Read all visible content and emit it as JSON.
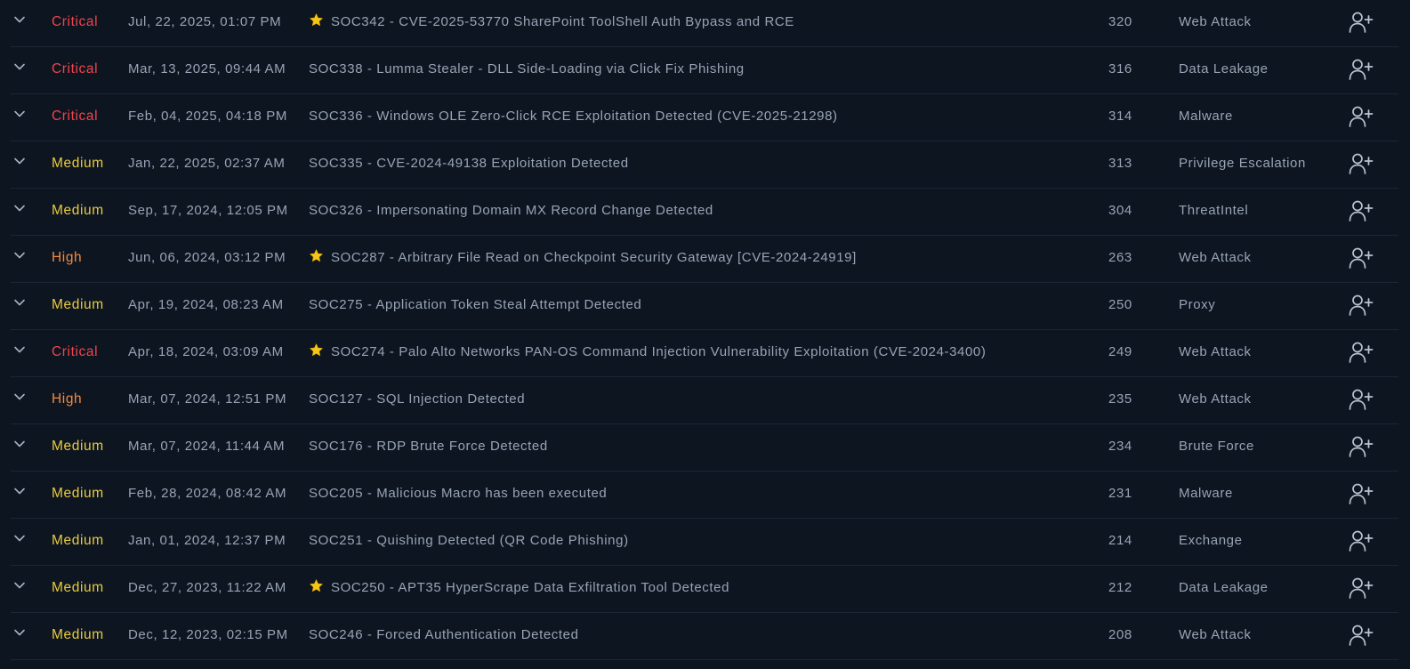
{
  "colors": {
    "background": "#0d1521",
    "row_divider": "#1c2634",
    "text": "#98a4b5",
    "critical": "#f0444a",
    "high": "#f48a3e",
    "medium": "#e9cb3c",
    "star": "#f5c518"
  },
  "icons": {
    "expand": "chevron-down-icon",
    "featured": "star-icon",
    "assign": "user-plus-icon"
  },
  "alerts": [
    {
      "severity": "Critical",
      "date": "Jul, 22, 2025, 01:07 PM",
      "starred": true,
      "rule": "SOC342 - CVE-2025-53770 SharePoint ToolShell Auth Bypass and RCE",
      "event_id": "320",
      "type": "Web Attack"
    },
    {
      "severity": "Critical",
      "date": "Mar, 13, 2025, 09:44 AM",
      "starred": false,
      "rule": "SOC338 - Lumma Stealer - DLL Side-Loading via Click Fix Phishing",
      "event_id": "316",
      "type": "Data Leakage"
    },
    {
      "severity": "Critical",
      "date": "Feb, 04, 2025, 04:18 PM",
      "starred": false,
      "rule": "SOC336 - Windows OLE Zero-Click RCE Exploitation Detected (CVE-2025-21298)",
      "event_id": "314",
      "type": "Malware"
    },
    {
      "severity": "Medium",
      "date": "Jan, 22, 2025, 02:37 AM",
      "starred": false,
      "rule": "SOC335 - CVE-2024-49138 Exploitation Detected",
      "event_id": "313",
      "type": "Privilege Escalation"
    },
    {
      "severity": "Medium",
      "date": "Sep, 17, 2024, 12:05 PM",
      "starred": false,
      "rule": "SOC326 - Impersonating Domain MX Record Change Detected",
      "event_id": "304",
      "type": "ThreatIntel"
    },
    {
      "severity": "High",
      "date": "Jun, 06, 2024, 03:12 PM",
      "starred": true,
      "rule": "SOC287 - Arbitrary File Read on Checkpoint Security Gateway [CVE-2024-24919]",
      "event_id": "263",
      "type": "Web Attack"
    },
    {
      "severity": "Medium",
      "date": "Apr, 19, 2024, 08:23 AM",
      "starred": false,
      "rule": "SOC275 - Application Token Steal Attempt Detected",
      "event_id": "250",
      "type": "Proxy"
    },
    {
      "severity": "Critical",
      "date": "Apr, 18, 2024, 03:09 AM",
      "starred": true,
      "rule": "SOC274 - Palo Alto Networks PAN-OS Command Injection Vulnerability Exploitation (CVE-2024-3400)",
      "event_id": "249",
      "type": "Web Attack"
    },
    {
      "severity": "High",
      "date": "Mar, 07, 2024, 12:51 PM",
      "starred": false,
      "rule": "SOC127 - SQL Injection Detected",
      "event_id": "235",
      "type": "Web Attack"
    },
    {
      "severity": "Medium",
      "date": "Mar, 07, 2024, 11:44 AM",
      "starred": false,
      "rule": "SOC176 - RDP Brute Force Detected",
      "event_id": "234",
      "type": "Brute Force"
    },
    {
      "severity": "Medium",
      "date": "Feb, 28, 2024, 08:42 AM",
      "starred": false,
      "rule": "SOC205 - Malicious Macro has been executed",
      "event_id": "231",
      "type": "Malware"
    },
    {
      "severity": "Medium",
      "date": "Jan, 01, 2024, 12:37 PM",
      "starred": false,
      "rule": "SOC251 - Quishing Detected (QR Code Phishing)",
      "event_id": "214",
      "type": "Exchange"
    },
    {
      "severity": "Medium",
      "date": "Dec, 27, 2023, 11:22 AM",
      "starred": true,
      "rule": "SOC250 - APT35 HyperScrape Data Exfiltration Tool Detected",
      "event_id": "212",
      "type": "Data Leakage"
    },
    {
      "severity": "Medium",
      "date": "Dec, 12, 2023, 02:15 PM",
      "starred": false,
      "rule": "SOC246 - Forced Authentication Detected",
      "event_id": "208",
      "type": "Web Attack"
    }
  ]
}
